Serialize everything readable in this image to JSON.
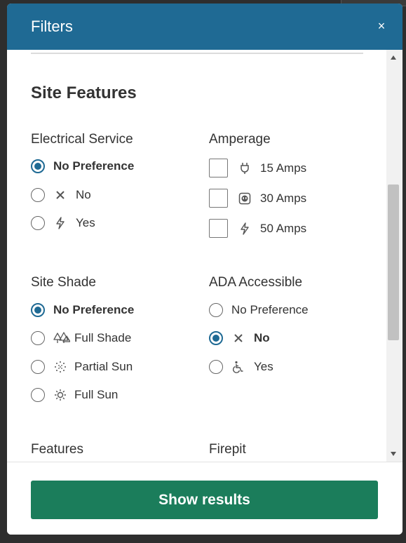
{
  "modal": {
    "title": "Filters",
    "close_symbol": "×"
  },
  "section": {
    "title": "Site Features"
  },
  "electrical_service": {
    "label": "Electrical Service",
    "options": [
      {
        "label": "No Preference",
        "selected": true,
        "icon": ""
      },
      {
        "label": "No",
        "selected": false,
        "icon": "x-icon"
      },
      {
        "label": "Yes",
        "selected": false,
        "icon": "lightning-bolt-icon"
      }
    ]
  },
  "amperage": {
    "label": "Amperage",
    "options": [
      {
        "label": "15 Amps",
        "checked": false,
        "icon": "plug-icon"
      },
      {
        "label": "30 Amps",
        "checked": false,
        "icon": "outlet-icon"
      },
      {
        "label": "50 Amps",
        "checked": false,
        "icon": "lightning-bolt-icon"
      }
    ]
  },
  "site_shade": {
    "label": "Site Shade",
    "options": [
      {
        "label": "No Preference",
        "selected": true,
        "icon": ""
      },
      {
        "label": "Full Shade",
        "selected": false,
        "icon": "trees-icon"
      },
      {
        "label": "Partial Sun",
        "selected": false,
        "icon": "partial-sun-icon"
      },
      {
        "label": "Full Sun",
        "selected": false,
        "icon": "sun-icon"
      }
    ]
  },
  "ada_accessible": {
    "label": "ADA Accessible",
    "options": [
      {
        "label": "No Preference",
        "selected": false,
        "icon": ""
      },
      {
        "label": "No",
        "selected": true,
        "icon": "x-icon"
      },
      {
        "label": "Yes",
        "selected": false,
        "icon": "wheelchair-icon"
      }
    ]
  },
  "features": {
    "label": "Features"
  },
  "firepit": {
    "label": "Firepit"
  },
  "footer": {
    "show_results_label": "Show results"
  },
  "colors": {
    "header": "#1f6a94",
    "primary_button": "#1b7d5b",
    "radio_selected": "#1f6a94"
  }
}
